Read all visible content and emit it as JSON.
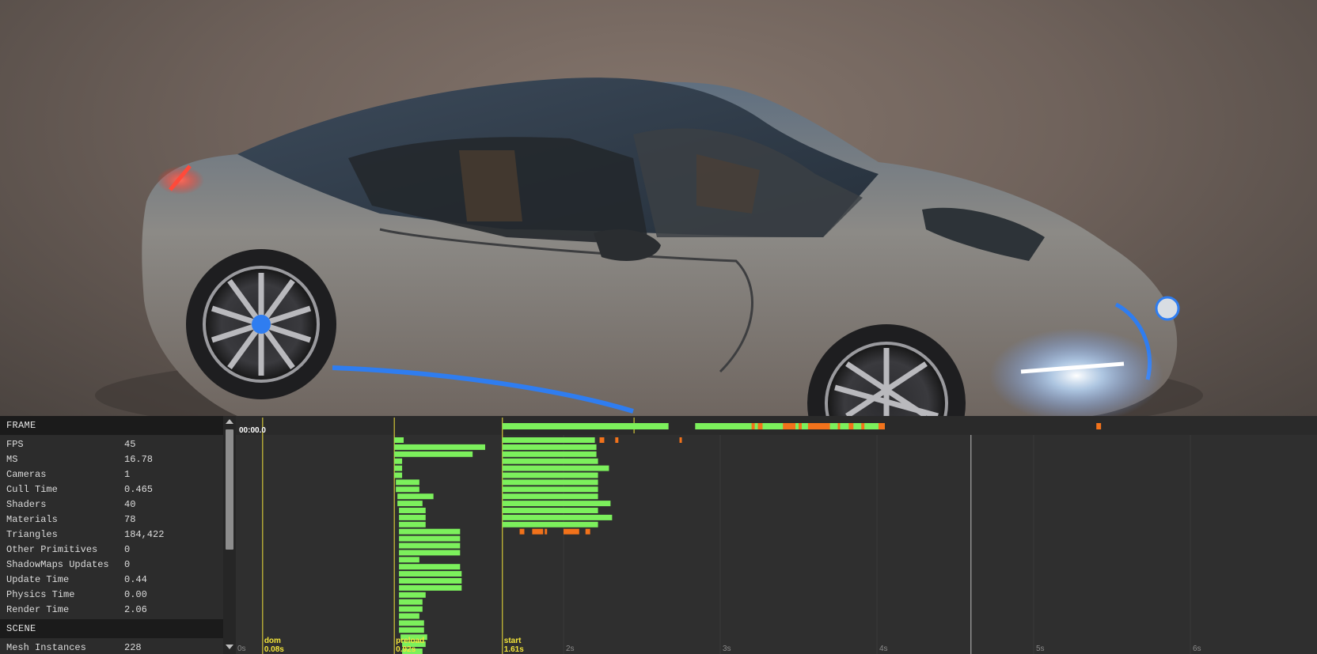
{
  "viewport": {
    "scene": "car-model-render",
    "colors": {
      "background": "#7a6c64",
      "body": "#8c8a86",
      "accent": "#2f7df0",
      "headlight": "#cfe6ff",
      "taillight": "#e0403a"
    }
  },
  "stats": {
    "sections": [
      {
        "title": "FRAME",
        "rows": [
          {
            "label": "FPS",
            "value": "45"
          },
          {
            "label": "MS",
            "value": "16.78"
          },
          {
            "label": "Cameras",
            "value": "1"
          },
          {
            "label": "Cull Time",
            "value": "0.465"
          },
          {
            "label": "Shaders",
            "value": "40"
          },
          {
            "label": "Materials",
            "value": "78"
          },
          {
            "label": "Triangles",
            "value": "184,422"
          },
          {
            "label": "Other Primitives",
            "value": "0"
          },
          {
            "label": "ShadowMaps Updates",
            "value": "0"
          },
          {
            "label": "Update Time",
            "value": "0.44"
          },
          {
            "label": "Physics Time",
            "value": "0.00"
          },
          {
            "label": "Render Time",
            "value": "2.06"
          }
        ]
      },
      {
        "title": "SCENE",
        "rows": [
          {
            "label": "Mesh Instances",
            "value": "228"
          }
        ]
      }
    ],
    "scroll_position": 0.0
  },
  "timeline": {
    "clock": "00:00.0",
    "seconds_visible": 6.3,
    "second_ticks": [
      {
        "t": 0,
        "label": "0s"
      },
      {
        "t": 2,
        "label": "2s"
      },
      {
        "t": 3,
        "label": "3s"
      },
      {
        "t": 4,
        "label": "4s"
      },
      {
        "t": 5,
        "label": "5s"
      },
      {
        "t": 6,
        "label": "6s"
      }
    ],
    "events": [
      {
        "name": "dom",
        "time": "0.08s",
        "t": 0.08
      },
      {
        "name": "preload",
        "time": "0.92s",
        "t": 0.92
      },
      {
        "name": "start",
        "time": "1.61s",
        "t": 1.61
      }
    ],
    "cursor_t": 4.6,
    "colors": {
      "event": "#f4e53a",
      "bar": "#7cf05c",
      "hitch": "#f2721b",
      "grid": "#3a3a3a",
      "cursor": "#bfbfbf"
    },
    "top_track": {
      "green_spans": [
        [
          1.61,
          2.67
        ],
        [
          2.84,
          4.05
        ]
      ],
      "orange_marks": [
        [
          3.2,
          3.22
        ],
        [
          3.24,
          3.27
        ],
        [
          3.4,
          3.48
        ],
        [
          3.5,
          3.52
        ],
        [
          3.56,
          3.7
        ],
        [
          3.75,
          3.76
        ],
        [
          3.82,
          3.85
        ],
        [
          3.9,
          3.92
        ],
        [
          4.01,
          4.05
        ],
        [
          5.4,
          5.43
        ]
      ]
    },
    "preload_bars": [
      [
        0.92,
        0.98
      ],
      [
        0.92,
        1.5
      ],
      [
        0.92,
        1.42
      ],
      [
        0.92,
        0.97
      ],
      [
        0.92,
        0.97
      ],
      [
        0.92,
        0.97
      ],
      [
        0.93,
        1.08
      ],
      [
        0.93,
        1.08
      ],
      [
        0.94,
        1.17
      ],
      [
        0.94,
        1.1
      ],
      [
        0.95,
        1.12
      ],
      [
        0.95,
        1.12
      ],
      [
        0.95,
        1.12
      ],
      [
        0.95,
        1.34
      ],
      [
        0.95,
        1.34
      ],
      [
        0.95,
        1.34
      ],
      [
        0.95,
        1.34
      ],
      [
        0.95,
        1.08
      ],
      [
        0.95,
        1.34
      ],
      [
        0.95,
        1.35
      ],
      [
        0.95,
        1.35
      ],
      [
        0.95,
        1.35
      ],
      [
        0.95,
        1.12
      ],
      [
        0.95,
        1.1
      ],
      [
        0.95,
        1.1
      ],
      [
        0.95,
        1.08
      ],
      [
        0.95,
        1.11
      ],
      [
        0.95,
        1.11
      ],
      [
        0.96,
        1.13
      ],
      [
        0.97,
        1.12
      ],
      [
        0.97,
        1.1
      ],
      [
        0.97,
        1.1
      ],
      [
        0.97,
        1.12
      ],
      [
        0.97,
        1.12
      ]
    ],
    "start_bars": [
      [
        1.61,
        2.2
      ],
      [
        1.61,
        2.21
      ],
      [
        1.61,
        2.21
      ],
      [
        1.61,
        2.22
      ],
      [
        1.61,
        2.29
      ],
      [
        1.61,
        2.22
      ],
      [
        1.61,
        2.22
      ],
      [
        1.61,
        2.22
      ],
      [
        1.61,
        2.22
      ],
      [
        1.61,
        2.3
      ],
      [
        1.61,
        2.22
      ],
      [
        1.61,
        2.31
      ],
      [
        1.61,
        2.22
      ]
    ],
    "start_extra_orange": [
      [
        2.23,
        2.26
      ],
      [
        2.33,
        2.35
      ],
      [
        2.74,
        2.75
      ]
    ],
    "start_orange_row": [
      [
        1.72,
        1.75
      ],
      [
        1.8,
        1.87
      ],
      [
        1.88,
        1.89
      ],
      [
        2.0,
        2.1
      ],
      [
        2.14,
        2.17
      ]
    ]
  }
}
